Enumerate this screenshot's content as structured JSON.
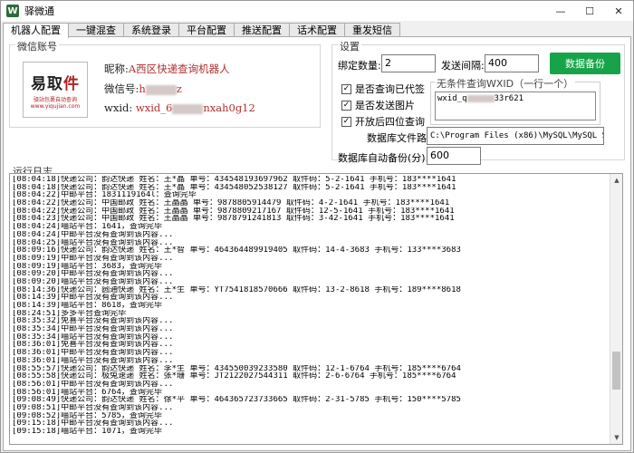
{
  "window": {
    "title": "驿微通",
    "icon_letter": "W",
    "minimize": "—",
    "maximize": "☐",
    "close": "✕"
  },
  "tabs": [
    {
      "label": "机器人配置",
      "active": true
    },
    {
      "label": "一键混查"
    },
    {
      "label": "系统登录"
    },
    {
      "label": "平台配置"
    },
    {
      "label": "推送配置"
    },
    {
      "label": "话术配置"
    },
    {
      "label": "重发短信"
    }
  ],
  "account": {
    "group_title": "微信账号",
    "avatar_logo_a": "易取",
    "avatar_logo_b": "件",
    "avatar_sub": "驿站包裹自动查询",
    "avatar_url": "www.yiqujian.com",
    "nickname_label": "昵称:",
    "nickname_value": "A西区快递查询机器人",
    "wechat_label": "微信号:",
    "wechat_value_a": "h",
    "wechat_value_b": "z",
    "wxid_label": "wxid:",
    "wxid_value_a": "wxid_6",
    "wxid_value_b": "nxah0g12"
  },
  "settings": {
    "group_title": "设置",
    "bind_count_label": "绑定数量:",
    "bind_count_value": "2",
    "send_interval_label": "发送间隔:",
    "send_interval_value": "400",
    "backup_button": "数据备份",
    "checkboxes": [
      {
        "label": "是否查询已代签",
        "checked": true
      },
      {
        "label": "是否发送图片",
        "checked": true
      },
      {
        "label": "开放后四位查询",
        "checked": true
      }
    ],
    "check_mark": "✓",
    "wxid_group_title": "无条件查询WXID（一行一个）",
    "wxid_list_a": "wxid_q",
    "wxid_list_b": "33r621",
    "db_path_label": "数据库文件路径:",
    "db_path_value": "C:\\Program Files (x86)\\MySQL\\MySQL Serve",
    "db_backup_label": "数据库自动备份(分):",
    "db_backup_value": "600"
  },
  "log": {
    "group_title": "运行日志",
    "scroll_up": "▲",
    "scroll_down": "▼",
    "lines": [
      "[08:04:18]快递公司：韵达快递 姓名：王*晶 单号：434548193697962 取件码：5-2-1641 手机号：183****1641",
      "[08:04:18]快递公司：韵达快递 姓名：王*晶 单号：434548052538127 取件码：5-2-1641 手机号：183****1641",
      "[08:04:22]中邮平台：1831119164l：查询完毕",
      "[08:04:22]快递公司：中国邮政 姓名：王晶晶 单号：9878805914479 取件码：4-2-1641 手机号：183****1641",
      "[08:04:22]快递公司：中国邮政 姓名：王晶晶 单号：9878809217167 取件码：12-5-1641 手机号：183****1641",
      "[08:04:23]快递公司：中国邮政 姓名：王晶晶 单号：9878791241813 取件码：3-42-1641 手机号：183****1641",
      "[08:04:24]喵站平台：1641，查询完毕",
      "[08:04:24]中邮平台没有查询到该内容...",
      "[08:04:25]喵站平台没有查询到该内容...",
      "[08:09:16]快递公司：韵达快递 姓名：王*智 单号：464364489919405 取件码：14-4-3683 手机号：133****3683",
      "[08:09:19]中邮平台没有查询到该内容...",
      "[08:09:19]喵站平台：3683，查询完毕",
      "[08:09:20]中邮平台没有查询到该内容...",
      "[08:09:20]喵站平台没有查询到该内容...",
      "[08:14:36]快递公司：圆通快递 姓名：王*生 单号：YT7541818570666 取件码：13-2-8618 手机号：189****8618",
      "[08:14:39]中邮平台没有查询到该内容...",
      "[08:14:39]喵站平台：8618，查询完毕",
      "[08:24:51]多多平台查询完毕",
      "[08:35:32]免喜平台没有查询到该内容...",
      "[08:35:34]中邮平台没有查询到该内容...",
      "[08:35:34]喵站平台没有查询到该内容...",
      "[08:36:01]免喜平台没有查询到该内容...",
      "[08:36:01]中邮平台没有查询到该内容...",
      "[08:36:01]喵站平台没有查询到该内容...",
      "[08:55:57]快递公司：韵达快递 姓名：李*生 单号：434550039233580 取件码：12-1-6764 手机号：185****6764",
      "[08:55:58]快递公司：极兔速递 姓名：张*珊 单号：JT2122027544311 取件码：2-6-6764 手机号：185****6764",
      "[08:56:01]中邮平台没有查询到该内容...",
      "[08:56:01]喵站平台：6764，查询完毕",
      "[09:08:49]快递公司：韵达快递 姓名：徐*平 单号：464365723733665 取件码：2-31-5785 手机号：150****5785",
      "[09:08:51]中邮平台没有查询到该内容...",
      "[09:08:52]喵站平台：5785，查询完毕",
      "[09:15:18]中邮平台没有查询到该内容...",
      "[09:15:18]喵站平台：1071，查询完毕"
    ]
  }
}
